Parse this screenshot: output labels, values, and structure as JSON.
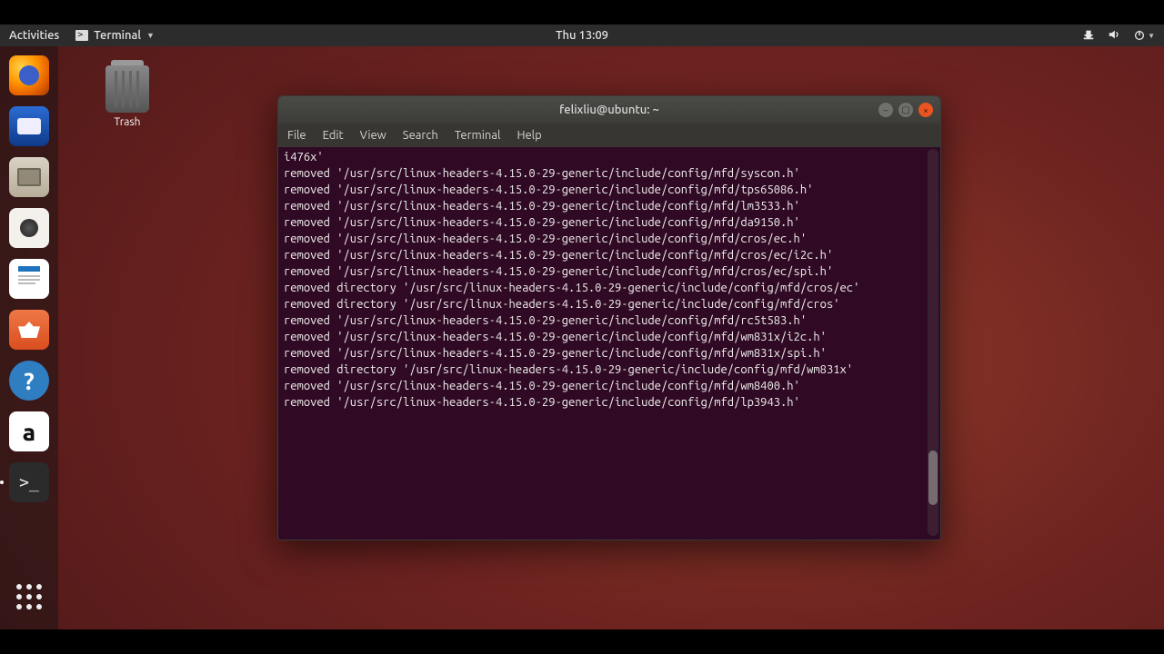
{
  "panel": {
    "activities": "Activities",
    "app_menu_label": "Terminal",
    "clock": "Thu 13:09"
  },
  "desktop": {
    "trash_label": "Trash"
  },
  "dock": {
    "items": [
      {
        "name": "firefox"
      },
      {
        "name": "thunderbird"
      },
      {
        "name": "files"
      },
      {
        "name": "rhythmbox"
      },
      {
        "name": "writer"
      },
      {
        "name": "software"
      },
      {
        "name": "help"
      },
      {
        "name": "amazon"
      },
      {
        "name": "terminal"
      }
    ]
  },
  "terminal": {
    "title": "felixliu@ubuntu: ~",
    "menu": {
      "file": "File",
      "edit": "Edit",
      "view": "View",
      "search": "Search",
      "terminal": "Terminal",
      "help": "Help"
    },
    "lines": [
      "i476x'",
      "removed '/usr/src/linux-headers-4.15.0-29-generic/include/config/mfd/syscon.h'",
      "removed '/usr/src/linux-headers-4.15.0-29-generic/include/config/mfd/tps65086.h'",
      "removed '/usr/src/linux-headers-4.15.0-29-generic/include/config/mfd/lm3533.h'",
      "removed '/usr/src/linux-headers-4.15.0-29-generic/include/config/mfd/da9150.h'",
      "removed '/usr/src/linux-headers-4.15.0-29-generic/include/config/mfd/cros/ec.h'",
      "removed '/usr/src/linux-headers-4.15.0-29-generic/include/config/mfd/cros/ec/i2c.h'",
      "removed '/usr/src/linux-headers-4.15.0-29-generic/include/config/mfd/cros/ec/spi.h'",
      "removed directory '/usr/src/linux-headers-4.15.0-29-generic/include/config/mfd/cros/ec'",
      "removed directory '/usr/src/linux-headers-4.15.0-29-generic/include/config/mfd/cros'",
      "removed '/usr/src/linux-headers-4.15.0-29-generic/include/config/mfd/rc5t583.h'",
      "removed '/usr/src/linux-headers-4.15.0-29-generic/include/config/mfd/wm831x/i2c.h'",
      "removed '/usr/src/linux-headers-4.15.0-29-generic/include/config/mfd/wm831x/spi.h'",
      "removed directory '/usr/src/linux-headers-4.15.0-29-generic/include/config/mfd/wm831x'",
      "removed '/usr/src/linux-headers-4.15.0-29-generic/include/config/mfd/wm8400.h'",
      "removed '/usr/src/linux-headers-4.15.0-29-generic/include/config/mfd/lp3943.h'"
    ]
  }
}
